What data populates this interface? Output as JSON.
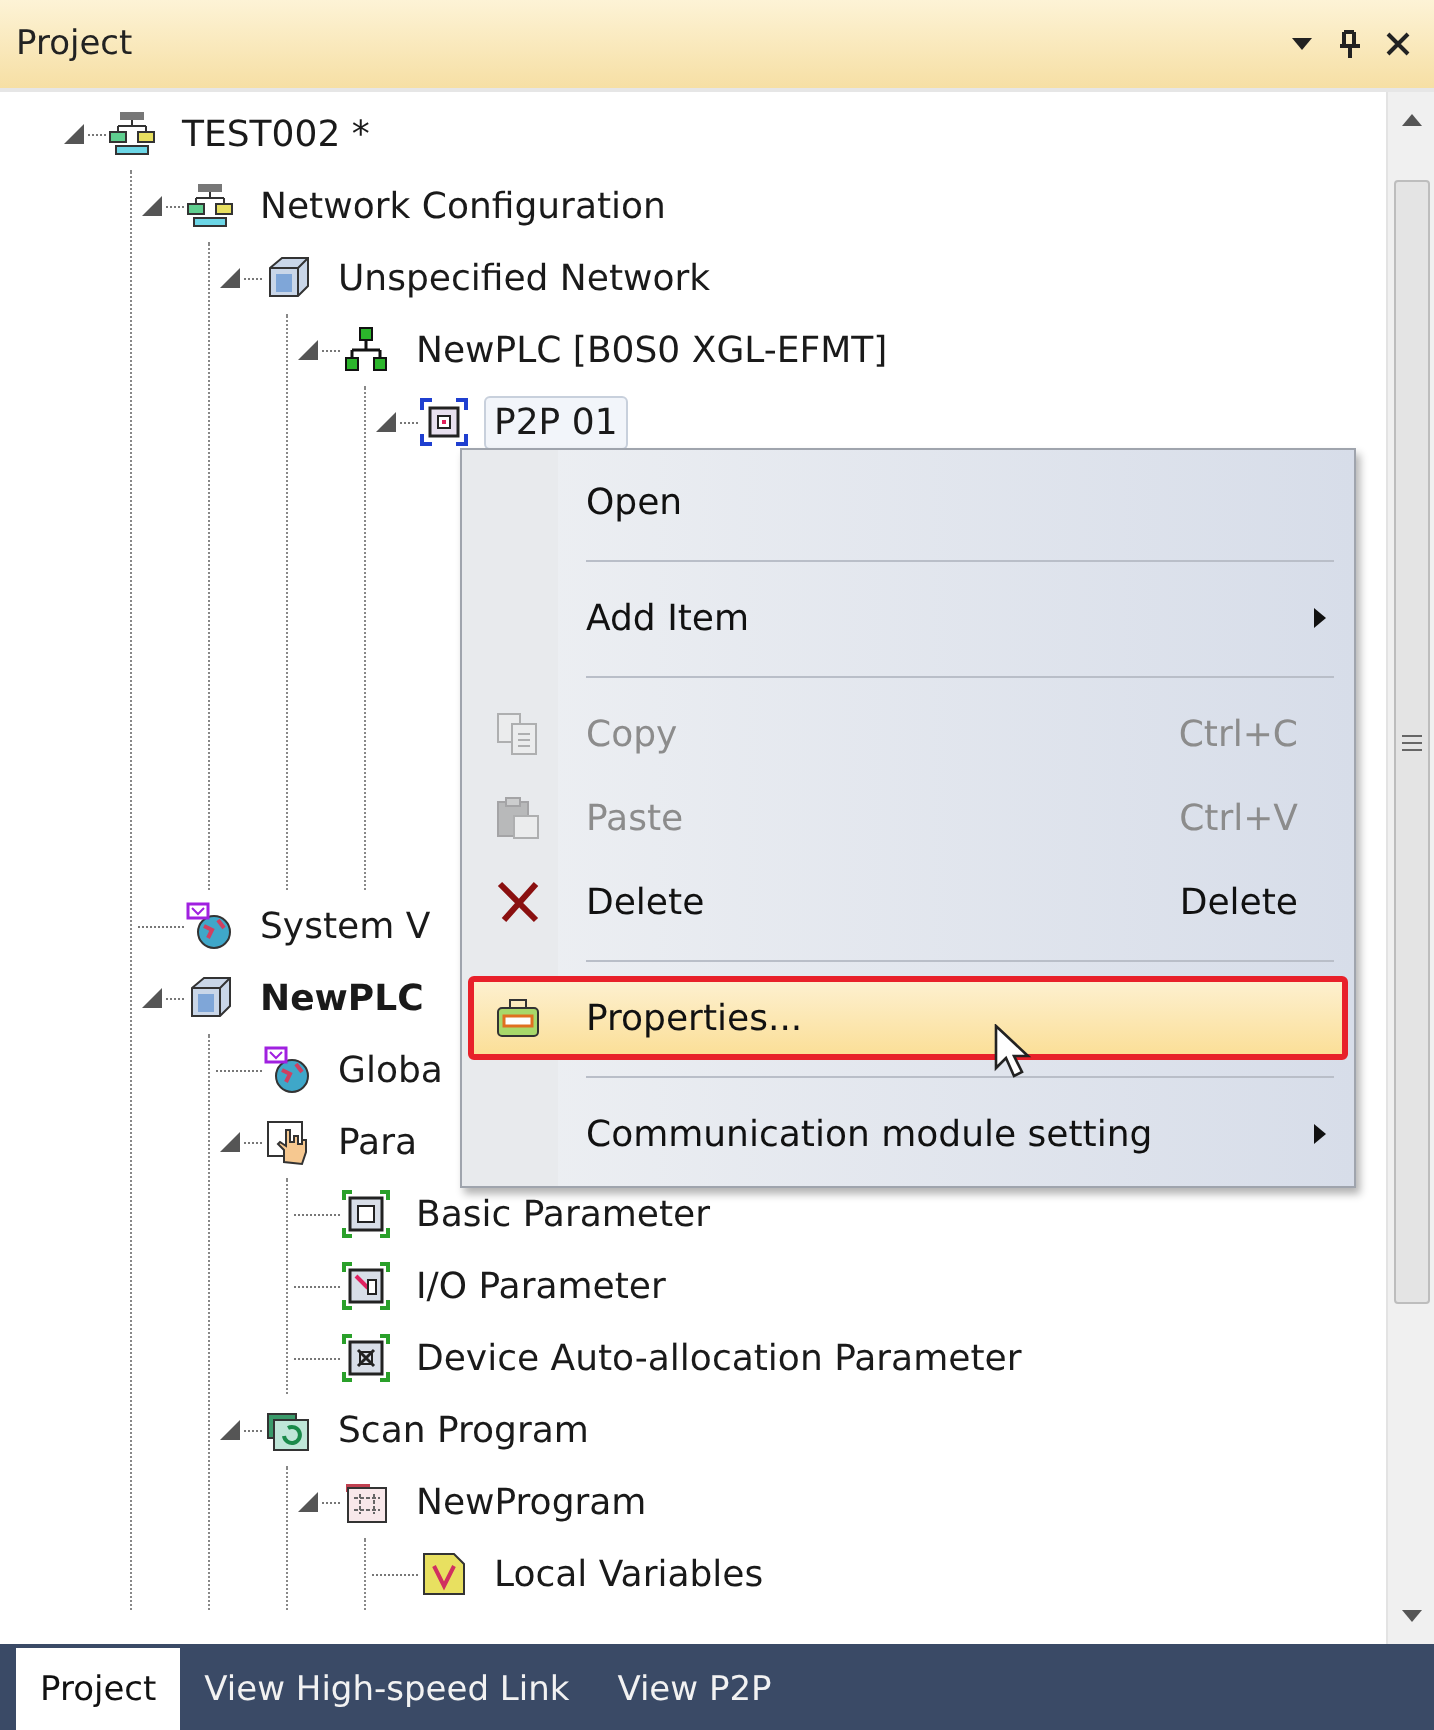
{
  "panel": {
    "title": "Project"
  },
  "tree": [
    {
      "label": "TEST002 *",
      "kind": "network",
      "expanded": true,
      "selected": false,
      "children": [
        {
          "label": "Network Configuration",
          "kind": "network",
          "expanded": true,
          "selected": false,
          "children": [
            {
              "label": "Unspecified Network",
              "kind": "rack",
              "expanded": true,
              "selected": false,
              "children": [
                {
                  "label": "NewPLC [B0S0 XGL-EFMT]",
                  "kind": "topology",
                  "expanded": true,
                  "selected": false,
                  "children": [
                    {
                      "label": "P2P 01",
                      "kind": "module",
                      "expanded": true,
                      "selected": true
                    }
                  ]
                }
              ]
            }
          ]
        },
        {
          "label": "System V",
          "kind": "globe",
          "selected": false
        },
        {
          "label": "NewPLC",
          "kind": "rack",
          "expanded": true,
          "selected": false,
          "active": true,
          "children": [
            {
              "label": "Globa",
              "kind": "globe",
              "selected": false
            },
            {
              "label": "Para",
              "kind": "hand",
              "expanded": true,
              "selected": false,
              "children": [
                {
                  "label": "Basic Parameter",
                  "kind": "param",
                  "selected": false
                },
                {
                  "label": "I/O Parameter",
                  "kind": "io",
                  "selected": false
                },
                {
                  "label": "Device Auto-allocation Parameter",
                  "kind": "device",
                  "selected": false
                }
              ]
            },
            {
              "label": "Scan Program",
              "kind": "scan",
              "expanded": true,
              "selected": false,
              "children": [
                {
                  "label": "NewProgram",
                  "kind": "program",
                  "expanded": true,
                  "selected": false,
                  "children": [
                    {
                      "label": "Local Variables",
                      "kind": "variables",
                      "selected": false
                    }
                  ]
                }
              ]
            }
          ]
        }
      ]
    }
  ],
  "context_menu": {
    "items": [
      {
        "kind": "command",
        "label": "Open",
        "disabled": false,
        "selected": false
      },
      {
        "kind": "separator"
      },
      {
        "kind": "submenu",
        "label": "Add Item",
        "disabled": false,
        "selected": false
      },
      {
        "kind": "separator"
      },
      {
        "kind": "copy",
        "label": "Copy",
        "shortcut": "Ctrl+C",
        "disabled": true,
        "selected": false
      },
      {
        "kind": "paste",
        "label": "Paste",
        "shortcut": "Ctrl+V",
        "disabled": true,
        "selected": false
      },
      {
        "kind": "delete",
        "label": "Delete",
        "shortcut": "Delete",
        "disabled": false,
        "selected": false
      },
      {
        "kind": "separator"
      },
      {
        "kind": "properties",
        "label": "Properties...",
        "disabled": false,
        "selected": true
      },
      {
        "kind": "separator"
      },
      {
        "kind": "submenu",
        "label": "Communication module setting",
        "disabled": false,
        "selected": false
      }
    ]
  },
  "tabs": [
    {
      "label": "Project",
      "selected": true
    },
    {
      "label": "View High-speed Link",
      "selected": false
    },
    {
      "label": "View P2P",
      "selected": false
    }
  ]
}
